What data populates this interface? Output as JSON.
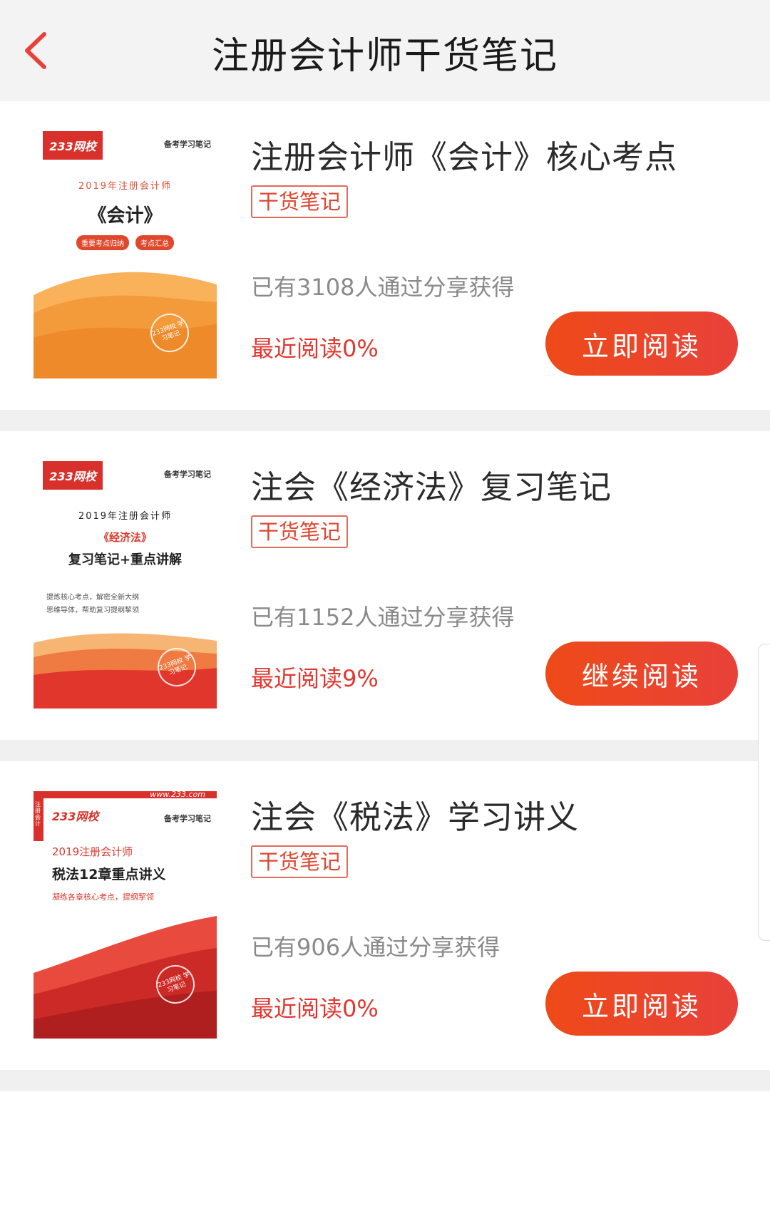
{
  "header": {
    "title": "注册会计师干货笔记",
    "back_icon": "chevron-left-icon",
    "accent_color": "#e8413a"
  },
  "cards": [
    {
      "title": "注册会计师《会计》核心考点",
      "badge": "干货笔记",
      "share_text": "已有3108人通过分享获得",
      "progress_text": "最近阅读0%",
      "button_label": "立即阅读",
      "cover": {
        "logo": "233网校",
        "tag": "备考学习笔记",
        "year": "2019年注册会计师",
        "subject": "《会计》",
        "pills": [
          "重要考点归纳",
          "考点汇总"
        ],
        "seal": "233网校 学习笔记"
      }
    },
    {
      "title": "注会《经济法》复习笔记",
      "badge": "干货笔记",
      "share_text": "已有1152人通过分享获得",
      "progress_text": "最近阅读9%",
      "button_label": "继续阅读",
      "cover": {
        "logo": "233网校",
        "tag": "备考学习笔记",
        "year": "2019年注册会计师",
        "subject": "《经济法》",
        "subtitle": "复习笔记+重点讲解",
        "bullets": [
          "提炼核心考点，解密全新大纲",
          "思维导体，帮助复习提纲挈领"
        ],
        "seal": "233网校 学习笔记"
      }
    },
    {
      "title": "注会《税法》学习讲义",
      "badge": "干货笔记",
      "share_text": "已有906人通过分享获得",
      "progress_text": "最近阅读0%",
      "button_label": "立即阅读",
      "cover": {
        "logo": "233网校",
        "url": "www.233.com",
        "side": "注册会计",
        "tag": "备考学习笔记",
        "year": "2019注册会计师",
        "subject": "税法12章重点讲义",
        "bullets": [
          "凝练各章核心考点，提纲挈领"
        ],
        "seal": "233网校 学习笔记"
      }
    }
  ]
}
